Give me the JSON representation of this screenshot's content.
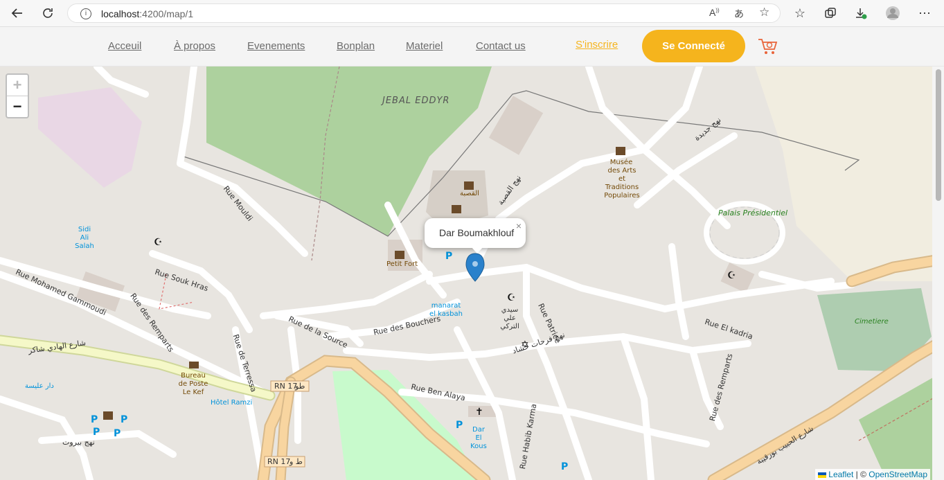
{
  "browser": {
    "url_host": "localhost",
    "url_rest": ":4200/map/1"
  },
  "nav": {
    "links": [
      "Acceuil",
      "À propos",
      "Evenements",
      "Bonplan",
      "Materiel",
      "Contact us"
    ],
    "signup": "S'inscrire",
    "connect": "Se Connecté"
  },
  "map": {
    "zoom_in": "+",
    "zoom_out": "−",
    "popup_title": "Dar Boumakhlouf",
    "popup_close": "×",
    "attribution_leaflet": "Leaflet",
    "attribution_sep": " | © ",
    "attribution_osm": "OpenStreetMap",
    "labels": {
      "jebal": "JEBAL EDDYR",
      "musee1": "Musée",
      "musee2": "des Arts",
      "musee3": "et Traditions",
      "musee4": "Populaires",
      "palais": "Palais Présidentiel",
      "cimetiere": "Cimetiere",
      "rue_mouldi": "Rue Mouldi",
      "rue_souk": "Rue Souk Hras",
      "rue_gammoudi": "Rue Mohamed Gammoudi",
      "rue_remparts": "Rue des Remparts",
      "rue_terressa": "Rue de Terressa",
      "rue_source": "Rue de la Source",
      "rue_bouchers": "Rue des Bouchers",
      "rue_ben_alaya": "Rue Ben Alaya",
      "rue_patrice": "Rue Patrice",
      "rue_kadria": "Rue El kadria",
      "rue_remparts2": "Rue des Remparts",
      "rue_karma": "Rue Habib Karma",
      "petit_fort": "Petit Fort",
      "sidi_ali1": "Sidi Ali",
      "sidi_ali2": "Salah",
      "manarat1": "manarat",
      "manarat2": "el kasbah",
      "bureau1": "Bureau",
      "bureau2": "de Poste",
      "bureau3": "Le Kef",
      "hotel": "Hôtel Ramzi",
      "dar_kous1": "Dar El",
      "dar_kous2": "Kous",
      "rn17a": "RN 17",
      "rn17b": "RN 17",
      "kasbah_ar": "القصبة",
      "sidi_ali_ar1": "سيدي علي",
      "sidi_ali_ar2": "التركي",
      "ar_dar": "دار عليسة",
      "ar_chaker": "شارع الهادي شاكر",
      "ar_bourguiba": "شارع الحبيب بورقيبة",
      "ar_beirut": "نهج بيروت",
      "ar_hached": "نهج فرحات حشاد",
      "ar_jdida": "نهج جديدة",
      "ar_kasba_st": "نهج القصبة",
      "ar_tw1": "طو",
      "ar_tw2": "ط و"
    }
  },
  "colors": {
    "accent": "#f5b41d",
    "marker": "#2a81cb",
    "road_major": "#f8d5a0",
    "park": "#add19e"
  }
}
